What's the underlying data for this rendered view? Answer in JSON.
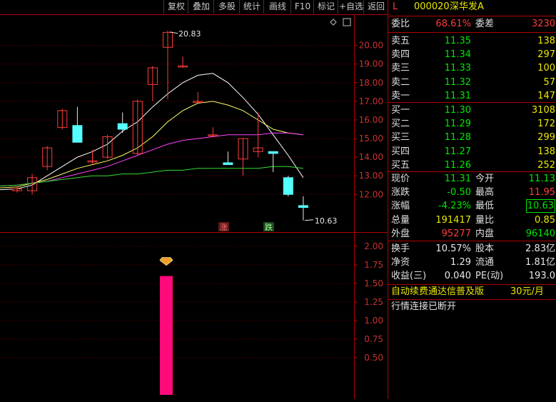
{
  "toolbar": {
    "buttons": [
      "复权",
      "叠加",
      "多股",
      "统计",
      "画线",
      "F10",
      "标记",
      "+自选",
      "返回"
    ]
  },
  "header": {
    "flag": "L",
    "code": "000020",
    "name": "深华发A"
  },
  "orderbook": {
    "weibi_label": "委比",
    "weibi_value": "68.61%",
    "weicha_label": "委差",
    "weicha_value": "3230",
    "asks": [
      {
        "label": "卖五",
        "price": "11.35",
        "volume": "138"
      },
      {
        "label": "卖四",
        "price": "11.34",
        "volume": "297"
      },
      {
        "label": "卖三",
        "price": "11.33",
        "volume": "100"
      },
      {
        "label": "卖二",
        "price": "11.32",
        "volume": "57"
      },
      {
        "label": "卖一",
        "price": "11.31",
        "volume": "147"
      }
    ],
    "bids": [
      {
        "label": "买一",
        "price": "11.30",
        "volume": "3108"
      },
      {
        "label": "买二",
        "price": "11.29",
        "volume": "172"
      },
      {
        "label": "买三",
        "price": "11.28",
        "volume": "299"
      },
      {
        "label": "买四",
        "price": "11.27",
        "volume": "138"
      },
      {
        "label": "买五",
        "price": "11.26",
        "volume": "252"
      }
    ]
  },
  "quote": {
    "rows": [
      {
        "l1": "现价",
        "v1": "11.31",
        "c1": "green",
        "l2": "今开",
        "v2": "11.13",
        "c2": "green"
      },
      {
        "l1": "涨跌",
        "v1": "-0.50",
        "c1": "green",
        "l2": "最高",
        "v2": "11.95",
        "c2": "red"
      },
      {
        "l1": "涨幅",
        "v1": "-4.23%",
        "c1": "green",
        "l2": "最低",
        "v2": "10.63",
        "c2": "green"
      },
      {
        "l1": "总量",
        "v1": "191417",
        "c1": "yellow",
        "l2": "量比",
        "v2": "0.85",
        "c2": "yellow"
      },
      {
        "l1": "外盘",
        "v1": "95277",
        "c1": "red",
        "l2": "内盘",
        "v2": "96140",
        "c2": "green"
      }
    ]
  },
  "fundamentals": {
    "rows": [
      {
        "l1": "换手",
        "v1": "10.57%",
        "l2": "股本",
        "v2": "2.83亿"
      },
      {
        "l1": "净资",
        "v1": "1.29",
        "l2": "流通",
        "v2": "1.81亿"
      },
      {
        "l1": "收益(三)",
        "v1": "0.040",
        "l2": "PE(动)",
        "v2": "193.0"
      }
    ]
  },
  "promo": {
    "text": "自动续费通达信普及版",
    "price": "30元/月"
  },
  "status": {
    "text": "行情连接已断开"
  },
  "chart_data": [
    {
      "type": "candlestick",
      "title": "",
      "ylim": [
        11.0,
        20.9
      ],
      "yticks": [
        "20.00",
        "19.00",
        "18.00",
        "17.00",
        "16.00",
        "15.00",
        "14.00",
        "13.00",
        "12.00"
      ],
      "annotations": {
        "high": "20.83",
        "low": "10.63",
        "rise_mark": "涨",
        "fall_mark": "跌"
      },
      "candles": [
        {
          "o": 12.2,
          "h": 12.4,
          "l": 12.1,
          "c": 12.3
        },
        {
          "o": 12.2,
          "h": 13.1,
          "l": 12.0,
          "c": 12.9
        },
        {
          "o": 13.5,
          "h": 14.6,
          "l": 13.3,
          "c": 14.5
        },
        {
          "o": 15.6,
          "h": 16.6,
          "l": 15.5,
          "c": 16.5
        },
        {
          "o": 15.7,
          "h": 16.7,
          "l": 14.8,
          "c": 14.8
        },
        {
          "o": 13.8,
          "h": 14.4,
          "l": 13.6,
          "c": 13.8
        },
        {
          "o": 14.0,
          "h": 15.2,
          "l": 13.9,
          "c": 15.1
        },
        {
          "o": 15.8,
          "h": 16.4,
          "l": 15.3,
          "c": 15.5
        },
        {
          "o": 14.2,
          "h": 17.1,
          "l": 14.1,
          "c": 17.0
        },
        {
          "o": 17.9,
          "h": 18.9,
          "l": 17.0,
          "c": 18.8
        },
        {
          "o": 19.9,
          "h": 20.8,
          "l": 17.1,
          "c": 20.7
        },
        {
          "o": 18.9,
          "h": 19.4,
          "l": 18.8,
          "c": 18.9
        },
        {
          "o": 17.0,
          "h": 17.5,
          "l": 16.9,
          "c": 17.0
        },
        {
          "o": 15.2,
          "h": 15.6,
          "l": 15.1,
          "c": 15.2
        },
        {
          "o": 13.7,
          "h": 14.3,
          "l": 13.7,
          "c": 13.6
        },
        {
          "o": 13.9,
          "h": 15.0,
          "l": 13.0,
          "c": 15.0
        },
        {
          "o": 14.3,
          "h": 16.4,
          "l": 14.0,
          "c": 14.5
        },
        {
          "o": 14.3,
          "h": 14.3,
          "l": 13.2,
          "c": 14.2
        },
        {
          "o": 12.9,
          "h": 13.0,
          "l": 11.9,
          "c": 12.0
        },
        {
          "o": 11.4,
          "h": 11.9,
          "l": 10.6,
          "c": 11.3
        }
      ],
      "ma": [
        {
          "color": "#ffffff",
          "values": [
            12.3,
            12.5,
            13.0,
            13.5,
            14.0,
            14.3,
            14.7,
            15.4,
            15.9,
            16.7,
            17.4,
            18.0,
            18.4,
            18.5,
            18.0,
            17.2,
            16.3,
            15.2,
            14.1,
            12.9
          ]
        },
        {
          "color": "#ffff66",
          "values": [
            12.4,
            12.6,
            12.8,
            13.1,
            13.4,
            13.6,
            13.8,
            14.1,
            14.5,
            15.1,
            15.9,
            16.5,
            16.9,
            17.0,
            16.8,
            16.5,
            16.0,
            15.5,
            15.3,
            15.2
          ]
        },
        {
          "color": "#ff44ff",
          "values": [
            12.5,
            12.6,
            12.7,
            12.9,
            13.1,
            13.3,
            13.5,
            13.8,
            14.1,
            14.4,
            14.7,
            14.9,
            15.0,
            15.1,
            15.2,
            15.2,
            15.2,
            15.3,
            15.3,
            15.2
          ]
        },
        {
          "color": "#33dd33",
          "values": [
            12.5,
            12.6,
            12.7,
            12.8,
            12.9,
            13.0,
            13.0,
            13.1,
            13.1,
            13.2,
            13.3,
            13.3,
            13.4,
            13.4,
            13.4,
            13.4,
            13.4,
            13.5,
            13.5,
            13.4
          ]
        }
      ]
    },
    {
      "type": "bar",
      "title": "",
      "ylim": [
        0,
        2.0
      ],
      "yticks": [
        "2.00",
        "1.75",
        "1.50",
        "1.25",
        "1.00",
        "0.75",
        "0.50"
      ],
      "bars": [
        {
          "index": 10,
          "value": 1.6,
          "color": "#ff0a7a"
        }
      ]
    }
  ]
}
